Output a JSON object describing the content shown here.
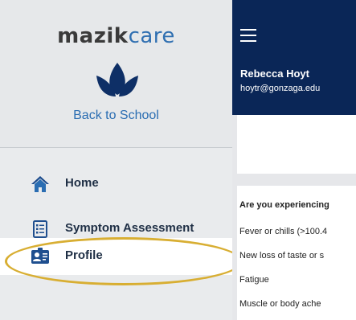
{
  "brand": {
    "logo_part1": "mazik",
    "logo_part2": "care",
    "subtitle": "Back to School",
    "leaf_icon": "lotus-leaf-icon",
    "accent_color": "#2f6fb1"
  },
  "nav": {
    "items": [
      {
        "label": "Home",
        "icon": "home-icon"
      },
      {
        "label": "Symptom Assessment",
        "icon": "clipboard-list-icon"
      },
      {
        "label": "Profile",
        "icon": "id-card-icon",
        "active": true
      }
    ]
  },
  "header": {
    "menu_icon": "hamburger-menu-icon",
    "user_name": "Rebecca Hoyt",
    "user_email": "hoytr@gonzaga.edu",
    "background_color": "#0a2657"
  },
  "assessment": {
    "question": "Are you experiencing",
    "symptoms": [
      "Fever or chills (>100.4",
      "New loss of taste or s",
      "Fatigue",
      "Muscle or body ache"
    ]
  },
  "annotation": {
    "color": "#d8ae32"
  }
}
